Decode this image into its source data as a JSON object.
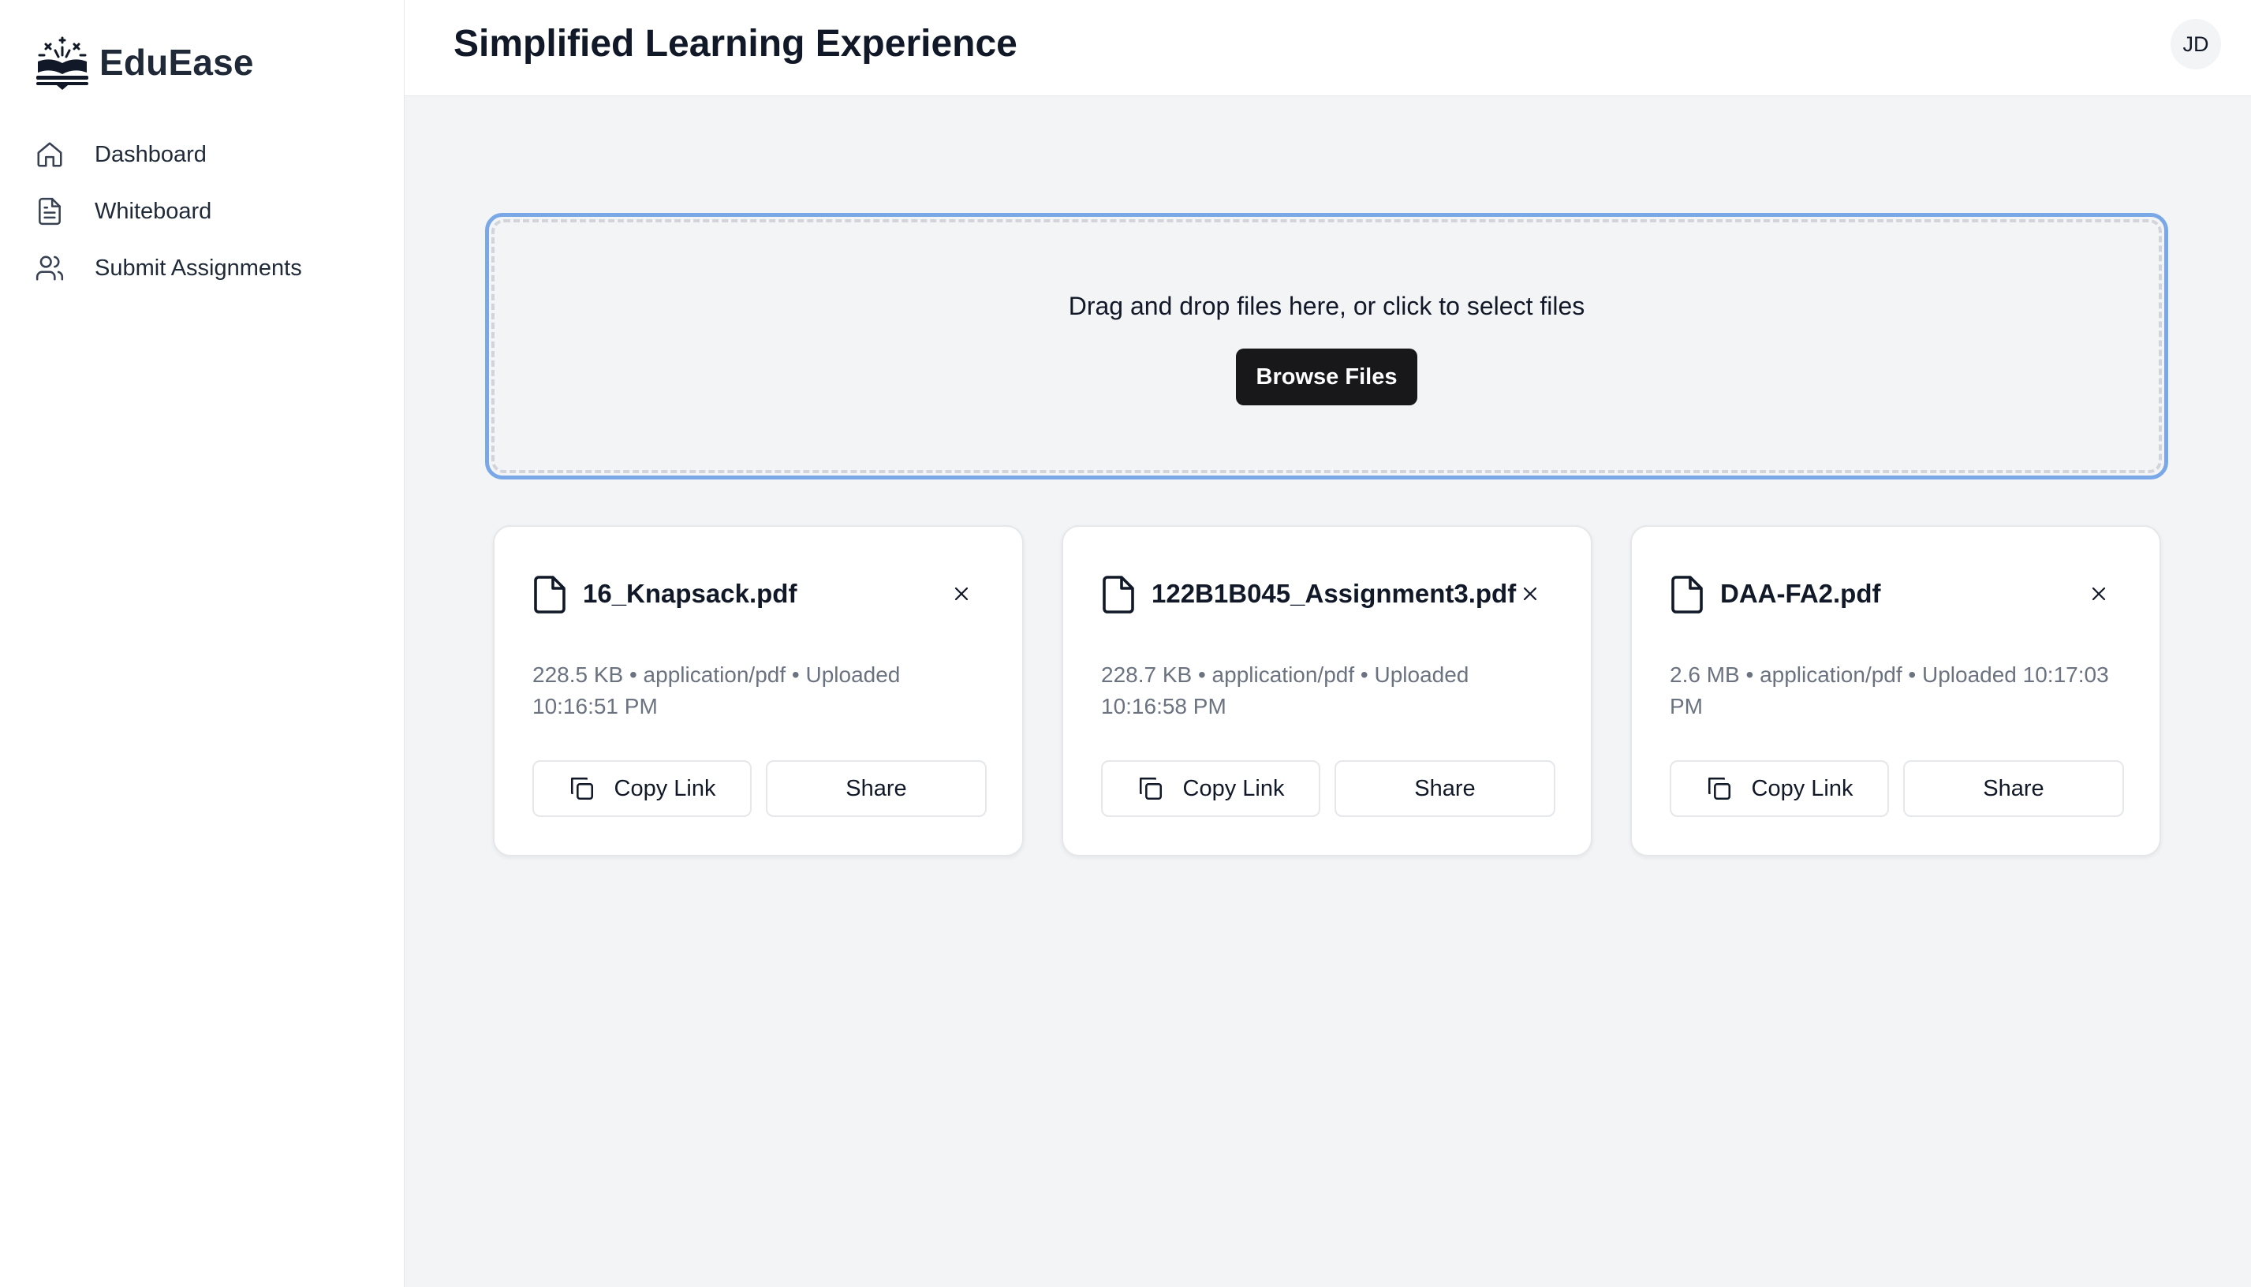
{
  "app": {
    "name": "EduEase",
    "logo_icon": "book-sparkle-icon"
  },
  "sidebar": {
    "items": [
      {
        "label": "Dashboard",
        "icon": "home-icon"
      },
      {
        "label": "Whiteboard",
        "icon": "document-icon"
      },
      {
        "label": "Submit Assignments",
        "icon": "users-icon"
      }
    ]
  },
  "header": {
    "title": "Simplified Learning Experience",
    "avatar_initials": "JD"
  },
  "upload": {
    "prompt": "Drag and drop files here, or click to select files",
    "browse_label": "Browse Files",
    "accent_color": "#7aa7e6"
  },
  "files": [
    {
      "name": "16_Knapsack.pdf",
      "size": "228.5 KB",
      "type": "application/pdf",
      "status": "Uploaded",
      "time": "10:16:51 PM",
      "meta": "228.5 KB • application/pdf • Uploaded 10:16:51 PM",
      "copy_label": "Copy Link",
      "share_label": "Share"
    },
    {
      "name": "122B1B045_Assignment3.pdf",
      "size": "228.7 KB",
      "type": "application/pdf",
      "status": "Uploaded",
      "time": "10:16:58 PM",
      "meta": "228.7 KB • application/pdf • Uploaded 10:16:58 PM",
      "copy_label": "Copy Link",
      "share_label": "Share"
    },
    {
      "name": "DAA-FA2.pdf",
      "size": "2.6 MB",
      "type": "application/pdf",
      "status": "Uploaded",
      "time": "10:17:03 PM",
      "meta": "2.6 MB • application/pdf • Uploaded 10:17:03 PM",
      "copy_label": "Copy Link",
      "share_label": "Share"
    }
  ]
}
